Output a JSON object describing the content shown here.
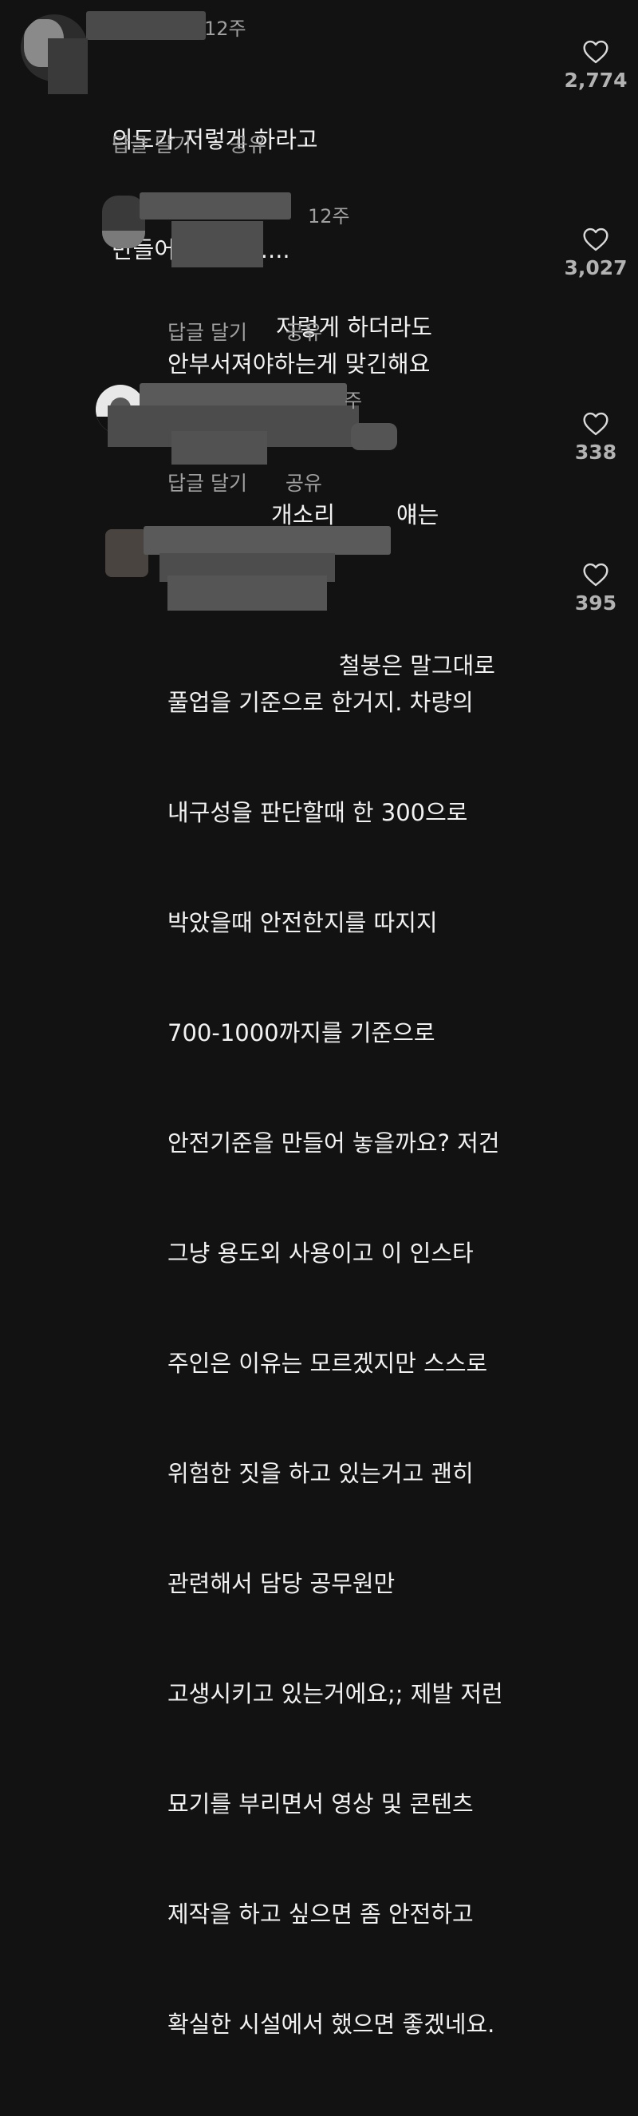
{
  "comments": [
    {
      "time": "12주",
      "lines": [
        "의도가 저렇게 하라고",
        "만들어놓은걸까...."
      ],
      "reply_label": "답글 달기",
      "share_label": "공유",
      "likes": "2,774"
    },
    {
      "time": "12주",
      "lines": [
        "저렇게 하더라도",
        "안부서져야하는게 맞긴해요"
      ],
      "reply_label": "답글 달기",
      "share_label": "공유",
      "likes": "3,027"
    },
    {
      "time": "주",
      "lines": [
        "개소리",
        "얘는"
      ],
      "reply_label": "답글 달기",
      "share_label": "공유",
      "likes": "338"
    },
    {
      "lines": [
        "철봉은 말그대로",
        "풀업을 기준으로 한거지. 차량의",
        "내구성을 판단할때 한 300으로",
        "박았을때 안전한지를 따지지",
        "700-1000까지를 기준으로",
        "안전기준을 만들어 놓을까요? 저건",
        "그냥 용도외 사용이고 이 인스타",
        "주인은 이유는 모르겠지만 스스로",
        "위험한 짓을 하고 있는거고 괜히",
        "관련해서 담당 공무원만",
        "고생시키고 있는거에요;; 제발 저런",
        "묘기를 부리면서 영상 및 콘텐츠",
        "제작을 하고 싶으면 좀 안전하고",
        "확실한 시설에서 했으면 좋겠네요."
      ],
      "likes": "395"
    }
  ],
  "icons": {
    "like": "heart-outline-icon"
  },
  "colors": {
    "background": "#121212",
    "text": "#f2f2f2",
    "secondary_text": "#a0a0a0"
  }
}
